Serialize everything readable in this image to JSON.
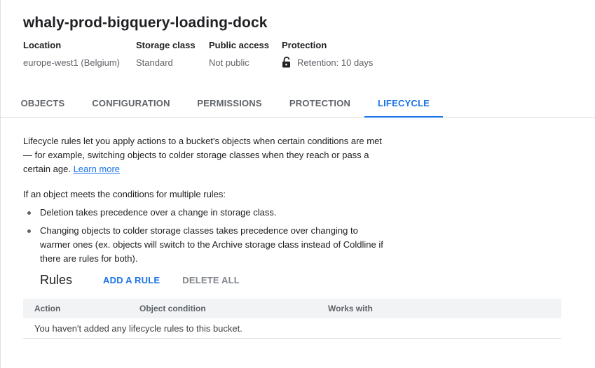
{
  "bucket": {
    "name": "whaly-prod-bigquery-loading-dock"
  },
  "meta": {
    "location": {
      "label": "Location",
      "value": "europe-west1 (Belgium)"
    },
    "storage_class": {
      "label": "Storage class",
      "value": "Standard"
    },
    "public_access": {
      "label": "Public access",
      "value": "Not public"
    },
    "protection": {
      "label": "Protection",
      "value": "Retention: 10 days",
      "icon": "lock-open-icon"
    }
  },
  "tabs": [
    {
      "label": "OBJECTS",
      "active": false
    },
    {
      "label": "CONFIGURATION",
      "active": false
    },
    {
      "label": "PERMISSIONS",
      "active": false
    },
    {
      "label": "PROTECTION",
      "active": false
    },
    {
      "label": "LIFECYCLE",
      "active": true
    }
  ],
  "lifecycle": {
    "intro": "Lifecycle rules let you apply actions to a bucket's objects when certain conditions are met — for example, switching objects to colder storage classes when they reach or pass a certain age.",
    "learn_more": "Learn more",
    "multiple_rules_heading": "If an object meets the conditions for multiple rules:",
    "bullets": [
      "Deletion takes precedence over a change in storage class.",
      "Changing objects to colder storage classes takes precedence over changing to warmer ones (ex. objects will switch to the Archive storage class instead of Coldline if there are rules for both)."
    ]
  },
  "rules": {
    "title": "Rules",
    "add_label": "ADD A RULE",
    "delete_all_label": "DELETE ALL",
    "columns": [
      "Action",
      "Object condition",
      "Works with"
    ],
    "empty_message": "You haven't added any lifecycle rules to this bucket."
  },
  "colors": {
    "accent": "#1a73e8",
    "text": "#202124",
    "muted": "#5f6368"
  }
}
